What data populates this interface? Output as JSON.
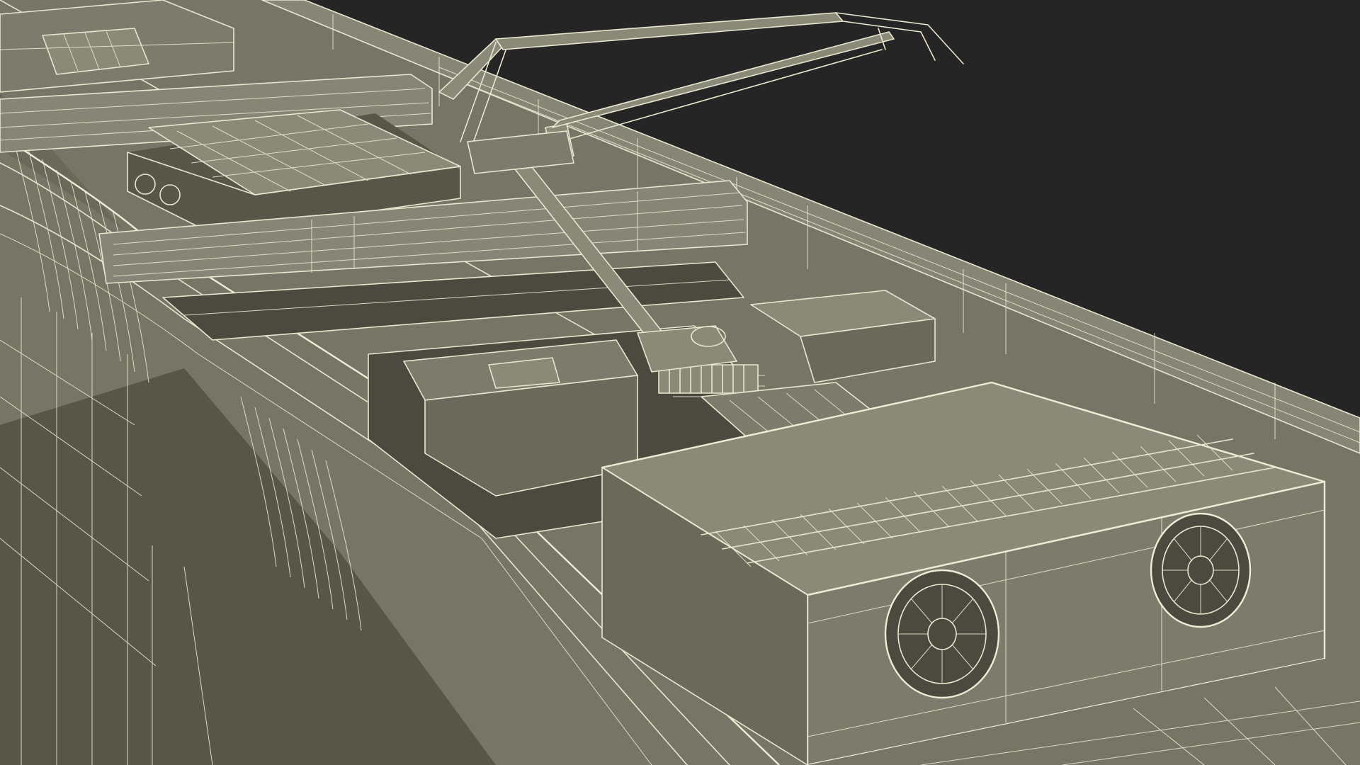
{
  "scene": {
    "background_color": "#252525",
    "model_fill_color": "#7a7a69",
    "wireframe_color": "#e9e6cf",
    "subject": "locomotive-roof-wireframe"
  }
}
